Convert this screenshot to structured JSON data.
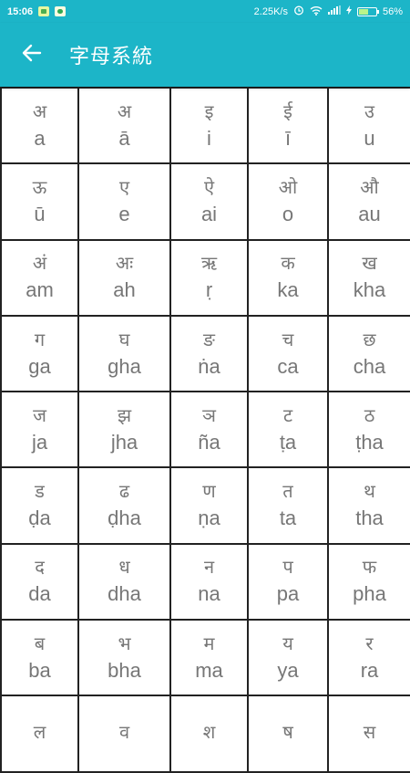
{
  "status_bar": {
    "time": "15:06",
    "network_speed": "2.25K/s",
    "battery_percent": "56%",
    "battery_level": 0.56
  },
  "app_bar": {
    "title": "字母系統",
    "back_icon": "arrow-left-icon"
  },
  "colors": {
    "primary": "#1cb5c8",
    "grid_line": "#222222",
    "text": "#777777"
  },
  "letters": [
    {
      "dev": "अ",
      "lat": "a"
    },
    {
      "dev": "अ",
      "lat": "ā"
    },
    {
      "dev": "इ",
      "lat": "i"
    },
    {
      "dev": "ई",
      "lat": "ī"
    },
    {
      "dev": "उ",
      "lat": "u"
    },
    {
      "dev": "ऊ",
      "lat": "ū"
    },
    {
      "dev": "ए",
      "lat": "e"
    },
    {
      "dev": "ऐ",
      "lat": "ai"
    },
    {
      "dev": "ओ",
      "lat": "o"
    },
    {
      "dev": "औ",
      "lat": "au"
    },
    {
      "dev": "अं",
      "lat": "am"
    },
    {
      "dev": "अः",
      "lat": "ah"
    },
    {
      "dev": "ऋ",
      "lat": "ṛ"
    },
    {
      "dev": "क",
      "lat": "ka"
    },
    {
      "dev": "ख",
      "lat": "kha"
    },
    {
      "dev": "ग",
      "lat": "ga"
    },
    {
      "dev": "घ",
      "lat": "gha"
    },
    {
      "dev": "ङ",
      "lat": "ṅa"
    },
    {
      "dev": "च",
      "lat": "ca"
    },
    {
      "dev": "छ",
      "lat": "cha"
    },
    {
      "dev": "ज",
      "lat": "ja"
    },
    {
      "dev": "झ",
      "lat": "jha"
    },
    {
      "dev": "ञ",
      "lat": "ña"
    },
    {
      "dev": "ट",
      "lat": "ṭa"
    },
    {
      "dev": "ठ",
      "lat": "ṭha"
    },
    {
      "dev": "ड",
      "lat": "ḍa"
    },
    {
      "dev": "ढ",
      "lat": "ḍha"
    },
    {
      "dev": "ण",
      "lat": "ṇa"
    },
    {
      "dev": "त",
      "lat": "ta"
    },
    {
      "dev": "थ",
      "lat": "tha"
    },
    {
      "dev": "द",
      "lat": "da"
    },
    {
      "dev": "ध",
      "lat": "dha"
    },
    {
      "dev": "न",
      "lat": "na"
    },
    {
      "dev": "प",
      "lat": "pa"
    },
    {
      "dev": "फ",
      "lat": "pha"
    },
    {
      "dev": "ब",
      "lat": "ba"
    },
    {
      "dev": "भ",
      "lat": "bha"
    },
    {
      "dev": "म",
      "lat": "ma"
    },
    {
      "dev": "य",
      "lat": "ya"
    },
    {
      "dev": "र",
      "lat": "ra"
    },
    {
      "dev": "ल",
      "lat": ""
    },
    {
      "dev": "व",
      "lat": ""
    },
    {
      "dev": "श",
      "lat": ""
    },
    {
      "dev": "ष",
      "lat": ""
    },
    {
      "dev": "स",
      "lat": ""
    }
  ]
}
